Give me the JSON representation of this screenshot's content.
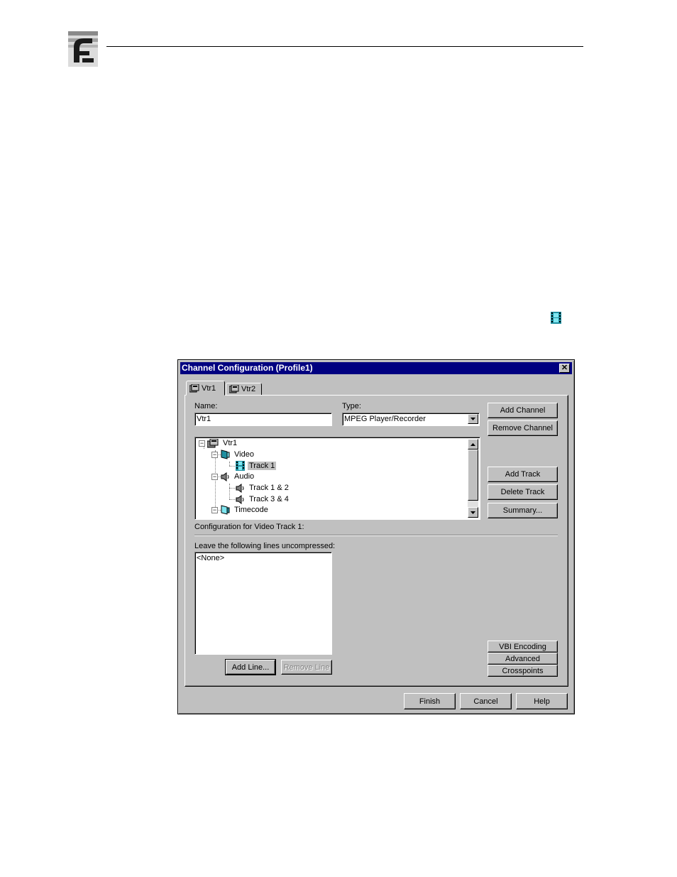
{
  "dialog": {
    "title": "Channel Configuration (Profile1)",
    "tabs": [
      {
        "label": "Vtr1",
        "active": true
      },
      {
        "label": "Vtr2",
        "active": false
      }
    ],
    "name_label": "Name:",
    "name_value": "Vtr1",
    "type_label": "Type:",
    "type_value": "MPEG Player/Recorder",
    "buttons": {
      "add_channel": "Add Channel",
      "remove_channel": "Remove Channel",
      "add_track": "Add Track",
      "delete_track": "Delete Track",
      "summary": "Summary...",
      "vbi_encoding": "VBI Encoding",
      "advanced": "Advanced",
      "crosspoints": "Crosspoints",
      "add_line": "Add Line...",
      "remove_line": "Remove Line",
      "finish": "Finish",
      "cancel": "Cancel",
      "help": "Help"
    },
    "tree": {
      "root": "Vtr1",
      "video": "Video",
      "video_track": "Track 1",
      "audio": "Audio",
      "audio_track_1": "Track 1 & 2",
      "audio_track_2": "Track 3 & 4",
      "timecode": "Timecode"
    },
    "config_label": "Configuration for Video Track 1:",
    "uncompressed_label": "Leave the following lines uncompressed:",
    "uncompressed_items": [
      "<None>"
    ]
  },
  "icons": {
    "logo": "company-logo",
    "inline": "film-track-icon"
  }
}
